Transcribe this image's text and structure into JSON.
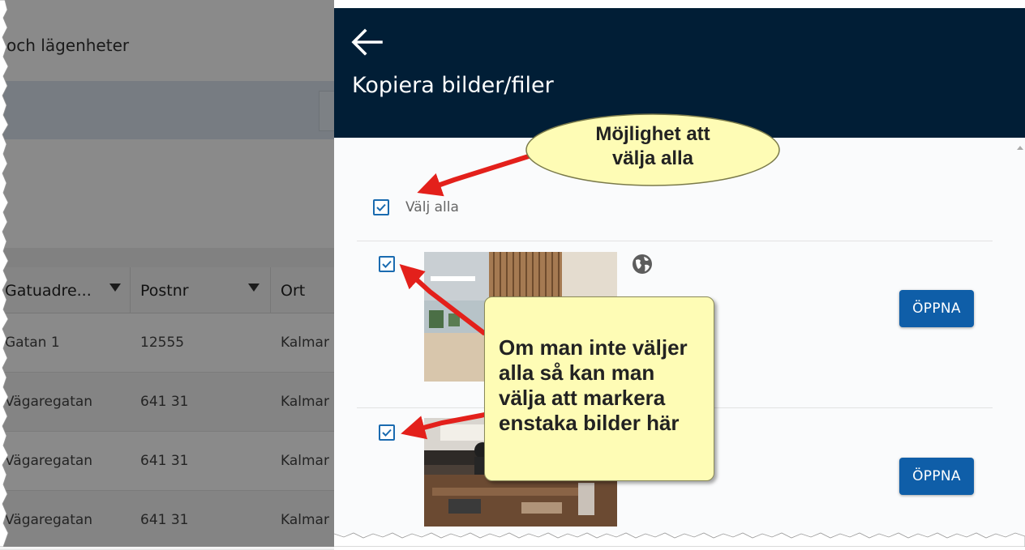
{
  "background": {
    "page_title": "och lägenheter",
    "table": {
      "columns": [
        "Gatuadre...",
        "Postnr",
        "Ort"
      ],
      "rows": [
        [
          "Gatan 1",
          "12555",
          "Kalmar"
        ],
        [
          "Vägaregatan",
          "641 31",
          "Kalmar"
        ],
        [
          "Vägaregatan",
          "641 31",
          "Kalmar"
        ],
        [
          "Vägaregatan",
          "641 31",
          "Kalmar"
        ]
      ]
    }
  },
  "drawer": {
    "title": "Kopiera bilder/filer",
    "select_all_label": "Välj alla",
    "select_all_checked": true,
    "items": [
      {
        "checked": true,
        "open_label": "ÖPPNA",
        "icon": "globe-icon"
      },
      {
        "checked": true,
        "open_label": "ÖPPNA"
      }
    ]
  },
  "annotations": {
    "top_callout": "Möjlighet att\nvälja alla",
    "bottom_callout": "Om man inte väljer\nalla så kan man\nvälja att markera\nenstaka bilder här"
  },
  "colors": {
    "header_bg": "#011e36",
    "accent": "#0f5ea8",
    "callout_fill": "#fefcb5",
    "arrow": "#e3201b"
  }
}
